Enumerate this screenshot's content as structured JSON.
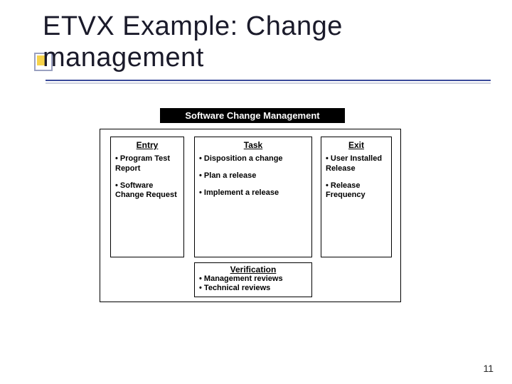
{
  "slide": {
    "title_line1": "ETVX Example: Change",
    "title_line2": "management",
    "page_number": "11"
  },
  "diagram": {
    "banner": "Software Change Management",
    "columns": {
      "entry": {
        "heading": "Entry",
        "items": [
          "Program Test Report",
          "Software Change Request"
        ]
      },
      "task": {
        "heading": "Task",
        "items": [
          "Disposition a change",
          "Plan a release",
          "Implement a release"
        ]
      },
      "exit": {
        "heading": "Exit",
        "items": [
          "User Installed Release",
          "Release Frequency"
        ]
      }
    },
    "verification": {
      "heading": "Verification",
      "items": [
        "Management reviews",
        "Technical reviews"
      ]
    }
  }
}
